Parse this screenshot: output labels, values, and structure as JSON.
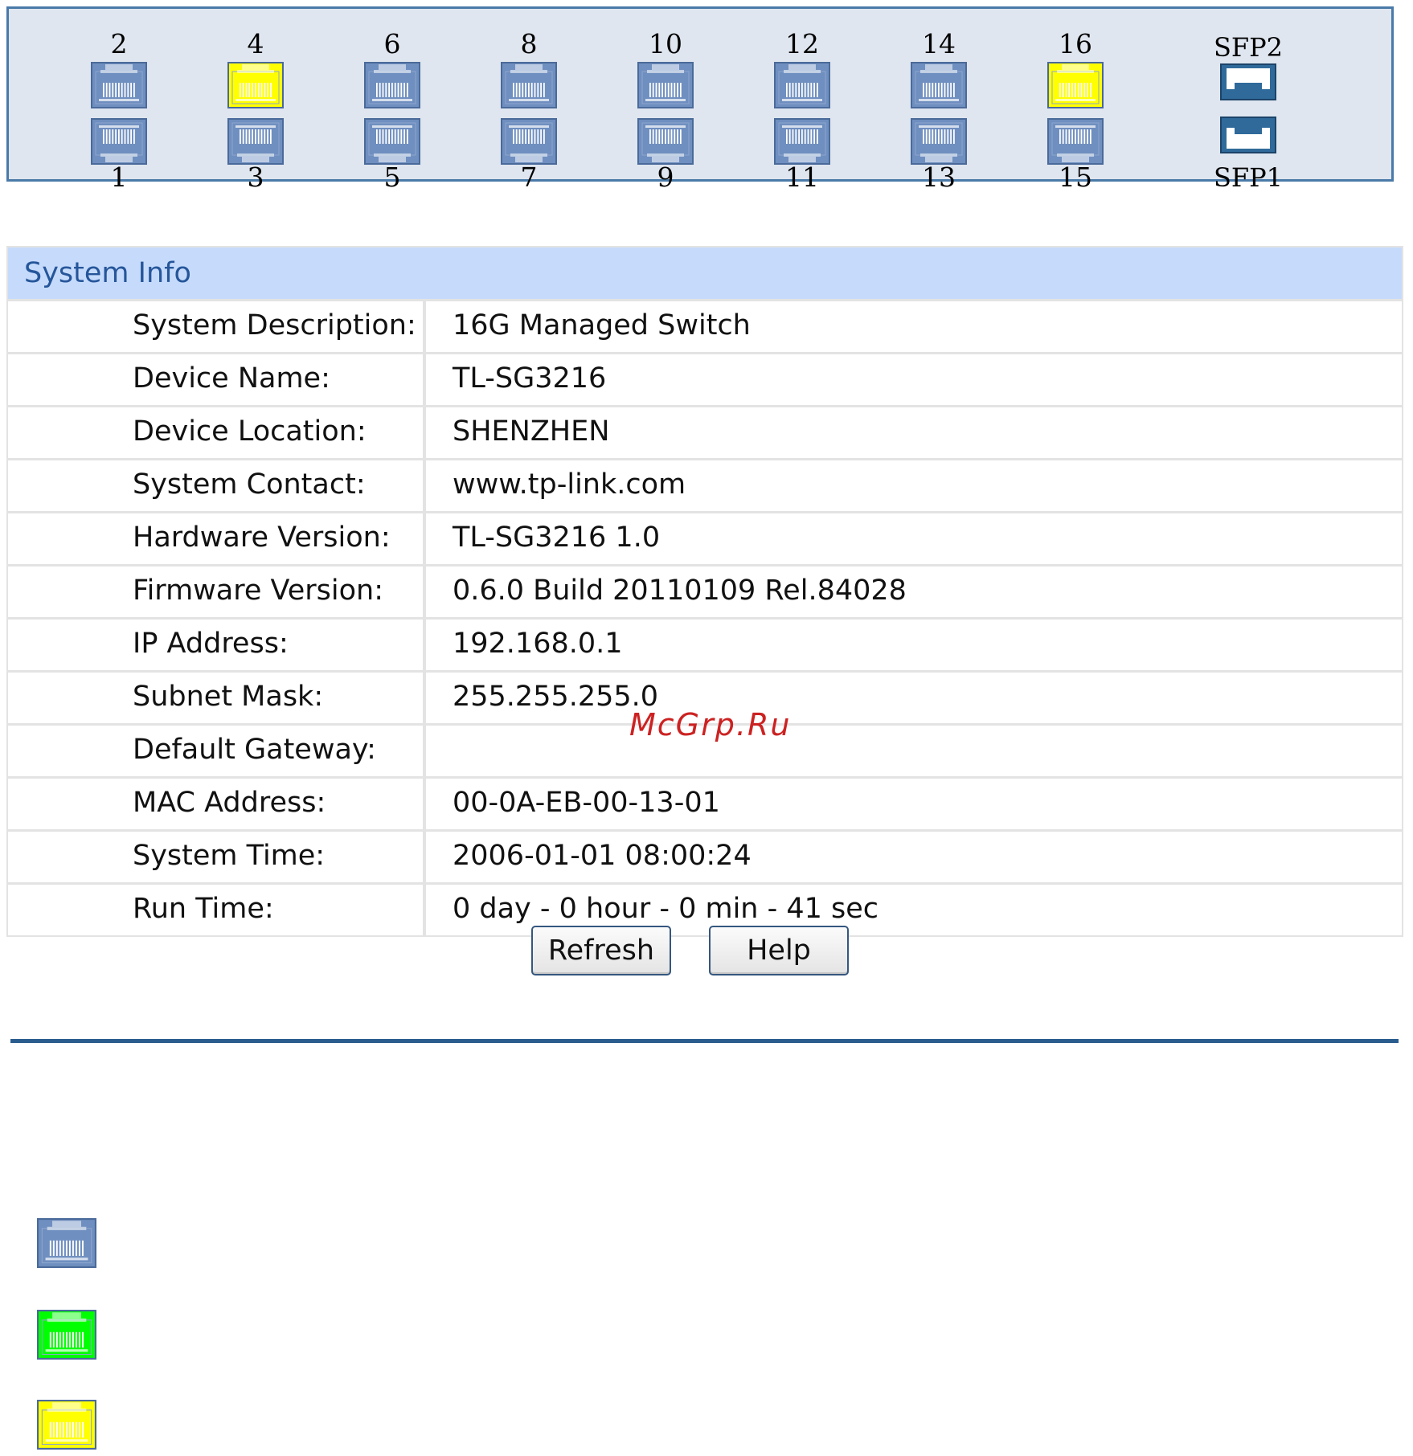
{
  "port_panel": {
    "top_ports": [
      {
        "number": "2",
        "status": "unlinked"
      },
      {
        "number": "4",
        "status": "linked-100m"
      },
      {
        "number": "6",
        "status": "unlinked"
      },
      {
        "number": "8",
        "status": "unlinked"
      },
      {
        "number": "10",
        "status": "unlinked"
      },
      {
        "number": "12",
        "status": "unlinked"
      },
      {
        "number": "14",
        "status": "unlinked"
      },
      {
        "number": "16",
        "status": "linked-100m"
      }
    ],
    "bottom_ports": [
      {
        "number": "1",
        "status": "unlinked"
      },
      {
        "number": "3",
        "status": "unlinked"
      },
      {
        "number": "5",
        "status": "unlinked"
      },
      {
        "number": "7",
        "status": "unlinked"
      },
      {
        "number": "9",
        "status": "unlinked"
      },
      {
        "number": "11",
        "status": "unlinked"
      },
      {
        "number": "13",
        "status": "unlinked"
      },
      {
        "number": "15",
        "status": "unlinked"
      }
    ],
    "sfp_top_label": "SFP2",
    "sfp_bottom_label": "SFP1"
  },
  "system_info": {
    "title": "System Info",
    "rows": [
      {
        "label": "System Description:",
        "value": "16G Managed Switch"
      },
      {
        "label": "Device Name:",
        "value": "TL-SG3216"
      },
      {
        "label": "Device Location:",
        "value": "SHENZHEN"
      },
      {
        "label": "System Contact:",
        "value": "www.tp-link.com"
      },
      {
        "label": "Hardware Version:",
        "value": "TL-SG3216 1.0"
      },
      {
        "label": "Firmware Version:",
        "value": "0.6.0 Build 20110109 Rel.84028"
      },
      {
        "label": "IP Address:",
        "value": "192.168.0.1"
      },
      {
        "label": "Subnet Mask:",
        "value": "255.255.255.0"
      },
      {
        "label": "Default Gateway:",
        "value": ""
      },
      {
        "label": "MAC Address:",
        "value": "00-0A-EB-00-13-01"
      },
      {
        "label": "System Time:",
        "value": "2006-01-01 08:00:24"
      },
      {
        "label": "Run Time:",
        "value": "0 day - 0 hour - 0 min - 41 sec"
      }
    ]
  },
  "buttons": {
    "refresh_label": "Refresh",
    "help_label": "Help"
  },
  "watermark": "McGrp.Ru",
  "legend": [
    {
      "icon": "port-unlinked-icon",
      "color": "#6f8fc0"
    },
    {
      "icon": "port-linked-1000m-icon",
      "color": "#00ff00"
    },
    {
      "icon": "port-linked-100m-icon",
      "color": "#ffff00"
    }
  ],
  "colors": {
    "panel_bg": "#dfe6ef",
    "panel_border": "#4a7aa8",
    "port_unlinked": "#6f8fc0",
    "port_linked_100m": "#ffff00",
    "port_linked_1000m": "#00ff00",
    "sfp": "#2f6a9a",
    "header_bg": "#c6dbfc",
    "header_text": "#26569a",
    "divider": "#2a5c8e"
  }
}
